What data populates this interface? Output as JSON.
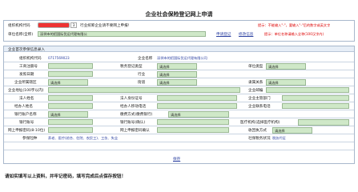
{
  "page": {
    "title": "企业社会保险登记网上申请"
  },
  "top": {
    "org_code_label": "组织机构代码",
    "industry_prompt": "行业统筹企业请不要网上申报!",
    "unit_name_label": "单位名称(全称)",
    "unit_name_value": "深圳市的招国际货运代理有限公",
    "hint1": "提示：不能输入\"-\"，要输入\"-\"后的数字或英文字",
    "hint2": "提示：单位名称请输入全称(100汉字内)",
    "link_apply": "申请登记",
    "link_query": "修改信息"
  },
  "section": {
    "title": "企业首次参保信息录入"
  },
  "form": {
    "org_code_label": "组织机构代码",
    "org_code_value": "0717569023",
    "company_name_label": "企业名称",
    "company_name_value": "深圳市的招国际货运代理有限公司",
    "work_place_label": "工商注册号",
    "enterprise_type_label": "单位类型",
    "enterprise_type_value": "请选择",
    "open_date_label": "发照日期",
    "approve_label": "税务登记类型",
    "approve_value": "请选择",
    "industry_label": "行业",
    "industry_value": "请选择",
    "region_label": "企业所属辖区",
    "region_value": "请选择",
    "street_label": "街道",
    "street_value": "请选择",
    "affiliation_label": "隶属关系",
    "affiliation_value": "请选择",
    "address_label": "企业地址(100字以内)",
    "postcode_label": "企业邮编",
    "legal_name_label": "法人姓名",
    "legal_id_label": "法人身份证号",
    "manager_label": "企业主管部门",
    "contact_label": "经办人姓名",
    "contact_phone_label": "经办人移动电话",
    "contact_tel_label": "企业联系电话",
    "bank_label": "银行账户名称",
    "bank_value": "请选择",
    "payment_label": "缴费方式(缴费银行)",
    "payment_value": "请选择",
    "account_label": "银行账号",
    "account_no_label": "银行账号(确认)",
    "institution_label": "医疗机构(选择医疗机构)",
    "online_label": "网上申报密码(8-10位)",
    "confirm_pwd_label": "网上申报密码确认",
    "receive_label": "收回执方式",
    "receive_value": "请选择",
    "insurance_label": "参保险种",
    "insurance_value": "养老、医疗(综合、住院、农民工)、工伤、失业",
    "social_label": "社保税务状况",
    "social_value": "税务代征"
  },
  "actions": {
    "save": "保存"
  },
  "footer": {
    "note": "请如实填写以上资料，并牢记密码，填写完成后点保存按钮！"
  }
}
